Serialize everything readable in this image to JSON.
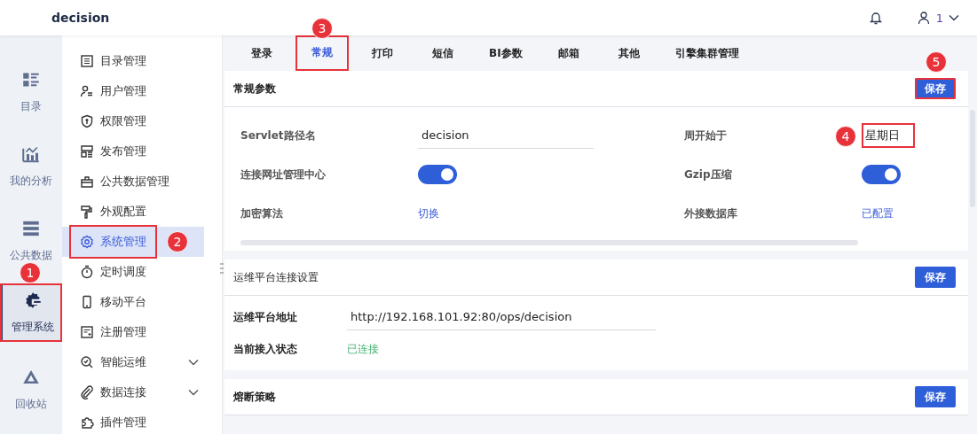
{
  "header": {
    "title": "decision",
    "user": "1"
  },
  "rail": [
    {
      "label": "目录",
      "selected": false
    },
    {
      "label": "我的分析",
      "selected": false
    },
    {
      "label": "公共数据",
      "selected": false
    },
    {
      "label": "管理系统",
      "selected": true,
      "callout": "1"
    },
    {
      "label": "回收站",
      "selected": false
    }
  ],
  "menu": [
    {
      "label": "目录管理",
      "selected": false,
      "expandable": false
    },
    {
      "label": "用户管理",
      "selected": false,
      "expandable": false
    },
    {
      "label": "权限管理",
      "selected": false,
      "expandable": false
    },
    {
      "label": "发布管理",
      "selected": false,
      "expandable": false
    },
    {
      "label": "公共数据管理",
      "selected": false,
      "expandable": false
    },
    {
      "label": "外观配置",
      "selected": false,
      "expandable": false
    },
    {
      "label": "系统管理",
      "selected": true,
      "expandable": false,
      "callout": "2"
    },
    {
      "label": "定时调度",
      "selected": false,
      "expandable": false
    },
    {
      "label": "移动平台",
      "selected": false,
      "expandable": false
    },
    {
      "label": "注册管理",
      "selected": false,
      "expandable": false
    },
    {
      "label": "智能运维",
      "selected": false,
      "expandable": true
    },
    {
      "label": "数据连接",
      "selected": false,
      "expandable": true
    },
    {
      "label": "插件管理",
      "selected": false,
      "expandable": false
    }
  ],
  "tabs": [
    {
      "label": "登录",
      "selected": false
    },
    {
      "label": "常规",
      "selected": true,
      "callout": "3"
    },
    {
      "label": "打印",
      "selected": false
    },
    {
      "label": "短信",
      "selected": false
    },
    {
      "label": "BI参数",
      "selected": false
    },
    {
      "label": "邮箱",
      "selected": false
    },
    {
      "label": "其他",
      "selected": false
    },
    {
      "label": "引擎集群管理",
      "selected": false
    }
  ],
  "general": {
    "title": "常规参数",
    "save": "保存",
    "save_callout": "5",
    "fields": [
      {
        "label": "Servlet路径名",
        "kind": "input",
        "value": "decision"
      },
      {
        "label": "周开始于",
        "kind": "input",
        "value": "星期日",
        "callout": "4"
      },
      {
        "label": "连接网址管理中心",
        "kind": "toggle",
        "on": true
      },
      {
        "label": "Gzip压缩",
        "kind": "toggle",
        "on": true
      },
      {
        "label": "加密算法",
        "kind": "link",
        "value": "切换"
      },
      {
        "label": "外接数据库",
        "kind": "link",
        "value": "已配置"
      }
    ]
  },
  "ops": {
    "title": "运维平台连接设置",
    "save": "保存",
    "fields": [
      {
        "label": "运维平台地址",
        "kind": "input",
        "value": "http://192.168.101.92:80/ops/decision"
      },
      {
        "label": "当前接入状态",
        "kind": "status",
        "value": "已连接"
      }
    ]
  },
  "circuit": {
    "title": "熔断策略",
    "save": "保存"
  }
}
